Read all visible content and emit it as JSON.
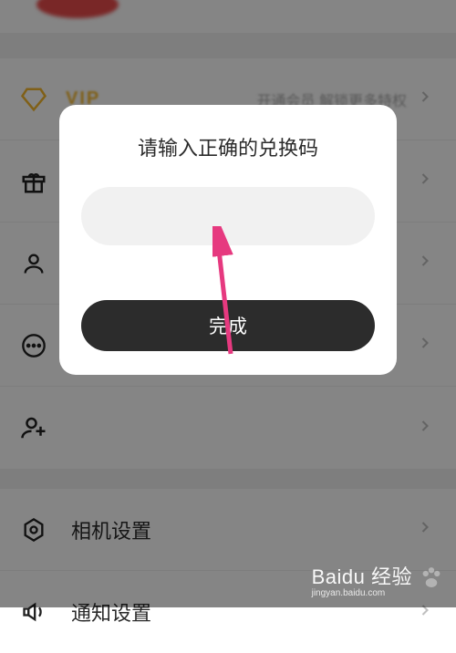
{
  "background": {
    "vip_label": "VIP",
    "vip_subtext": "开通会员 解锁更多特权",
    "items": [
      {
        "icon": "gift-icon",
        "label": ""
      },
      {
        "icon": "user-icon",
        "label": ""
      },
      {
        "icon": "more-icon",
        "label": ""
      },
      {
        "icon": "add-user-icon",
        "label": ""
      }
    ],
    "items2": [
      {
        "icon": "settings-icon",
        "label": "相机设置"
      },
      {
        "icon": "sound-icon",
        "label": "通知设置"
      }
    ]
  },
  "dialog": {
    "title": "请输入正确的兑换码",
    "input_placeholder": "",
    "confirm_label": "完成"
  },
  "watermark": {
    "brand": "Baidu 经验",
    "url": "jingyan.baidu.com"
  }
}
